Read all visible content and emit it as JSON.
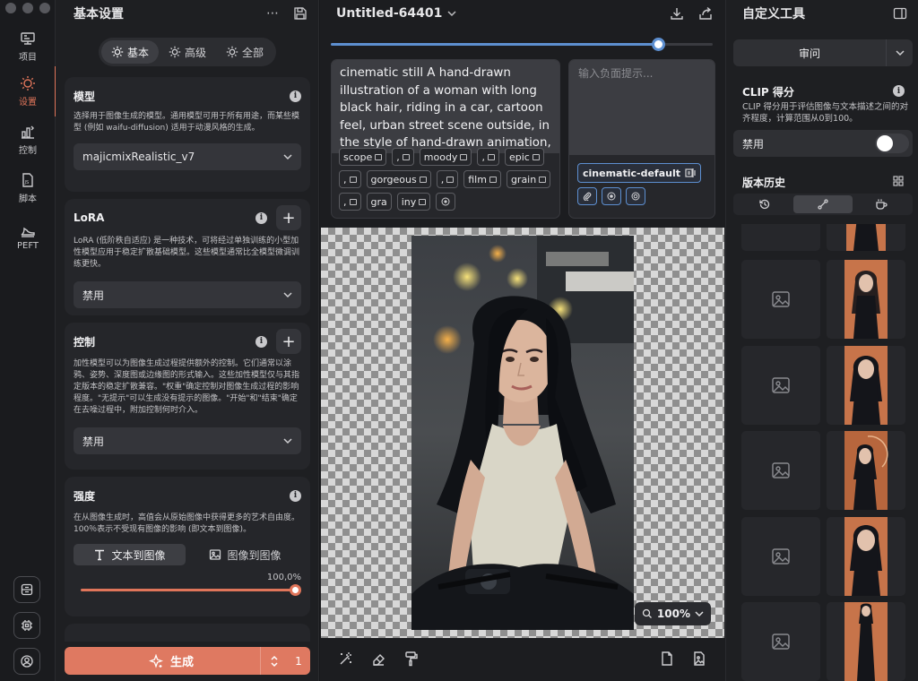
{
  "rail": {
    "items": [
      {
        "label": "项目",
        "icon": "project-icon"
      },
      {
        "label": "设置",
        "icon": "settings-sun-icon"
      },
      {
        "label": "控制",
        "icon": "control-icon"
      },
      {
        "label": "脚本",
        "icon": "script-icon"
      },
      {
        "label": "PEFT",
        "icon": "peft-icon"
      }
    ],
    "active": "设置"
  },
  "settings": {
    "title": "基本设置",
    "tabs": [
      "基本",
      "高级",
      "全部"
    ],
    "active_tab": "基本",
    "model": {
      "title": "模型",
      "desc": "选择用于图像生成的模型。通用模型可用于所有用途，而某些模型 (例如 waifu-diffusion) 适用于动漫风格的生成。",
      "value": "majicmixRealistic_v7"
    },
    "lora": {
      "title": "LoRA",
      "desc": "LoRA (低阶秩自适应) 是一种技术，可将经过单独训练的小型加性模型应用于稳定扩散基础模型。这些模型通常比全模型微调训练更快。",
      "value": "禁用"
    },
    "control": {
      "title": "控制",
      "desc": "加性模型可以为图像生成过程提供额外的控制。它们通常以涂鸦、姿势、深度图或边缘图的形式输入。这些加性模型仅与其指定版本的稳定扩散兼容。\"权重\"确定控制对图像生成过程的影响程度。\"无提示\"可以生成没有提示的图像。\"开始\"和\"结束\"确定在去噪过程中，附加控制何时介入。",
      "value": "禁用"
    },
    "strength": {
      "title": "强度",
      "desc": "在从图像生成时，高值会从原始图像中获得更多的艺术自由度。100％表示不受现有图像的影响 (即文本到图像)。",
      "mode_text": "文本到图像",
      "mode_image": "图像到图像",
      "value_label": "100,0%",
      "value": 1.0
    },
    "generate": {
      "label": "生成",
      "count": "1"
    }
  },
  "canvas": {
    "title": "Untitled-64401",
    "steps_fraction": 0.86,
    "prompt": "cinematic still A hand-drawn illustration of a woman with long black hair, riding in a car, cartoon feel, urban street scene outside, in the style of hand-drawn animation, with clear",
    "chips": [
      {
        "t": "scope",
        "i": true
      },
      {
        "t": ",",
        "i": true
      },
      {
        "t": "moody",
        "i": true
      },
      {
        "t": ",",
        "i": true
      },
      {
        "t": "epic",
        "i": true
      },
      {
        "t": ",",
        "i": true
      },
      {
        "t": "gorgeous",
        "i": true
      },
      {
        "t": ",",
        "i": true
      },
      {
        "t": "film",
        "i": true
      },
      {
        "t": "grain",
        "i": true
      },
      {
        "t": ",",
        "i": true
      },
      {
        "t": "gra",
        "i": false
      },
      {
        "t": "iny",
        "i": true
      },
      {
        "t": "",
        "i": false,
        "gear": true
      }
    ],
    "negative_placeholder": "输入负面提示...",
    "style": "cinematic-default",
    "zoom": "100%"
  },
  "custom_tools": {
    "title": "自定义工具",
    "ask_label": "审问",
    "clip_title": "CLIP 得分",
    "clip_desc": "CLIP 得分用于评估图像与文本描述之间的对齐程度，计算范围从0到100。",
    "clip_toggle_label": "禁用",
    "history_title": "版本历史"
  },
  "colors": {
    "accent": "#df7961",
    "blue": "#5d8fd0"
  }
}
